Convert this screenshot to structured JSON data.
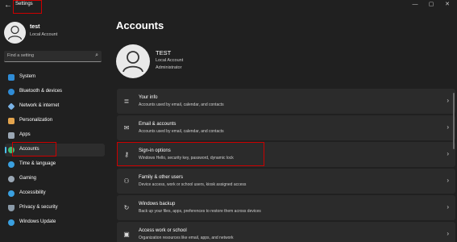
{
  "window": {
    "title": "Settings",
    "back_glyph": "←",
    "minimize_glyph": "—",
    "maximize_glyph": "▢",
    "close_glyph": "✕"
  },
  "sidebar": {
    "user": {
      "name": "test",
      "role": "Local Account"
    },
    "search": {
      "placeholder": "Find a setting",
      "icon": "search-icon"
    },
    "items": [
      {
        "label": "System",
        "icon": "system-icon",
        "color": "#2f8cd6"
      },
      {
        "label": "Bluetooth & devices",
        "icon": "bluetooth-icon",
        "color": "#2f8cd6"
      },
      {
        "label": "Network & internet",
        "icon": "network-icon",
        "color": "#7ab3e6"
      },
      {
        "label": "Personalization",
        "icon": "brush-icon",
        "color": "#e3a44d"
      },
      {
        "label": "Apps",
        "icon": "apps-icon",
        "color": "#9aa7b4"
      },
      {
        "label": "Accounts",
        "icon": "accounts-icon",
        "color": "#3fbf72",
        "active": true
      },
      {
        "label": "Time & language",
        "icon": "globe-icon",
        "color": "#3aa0e0"
      },
      {
        "label": "Gaming",
        "icon": "gaming-icon",
        "color": "#9aa7b4"
      },
      {
        "label": "Accessibility",
        "icon": "accessibility-icon",
        "color": "#3aa0e0"
      },
      {
        "label": "Privacy & security",
        "icon": "shield-icon",
        "color": "#8a9aa8"
      },
      {
        "label": "Windows Update",
        "icon": "update-icon",
        "color": "#3aa0e0"
      }
    ]
  },
  "main": {
    "title": "Accounts",
    "account": {
      "name": "TEST",
      "type": "Local Account",
      "role": "Administrator"
    },
    "cards": [
      {
        "title": "Your info",
        "desc": "Accounts used by email, calendar, and contacts",
        "icon": "person-card-icon",
        "glyph": "≣"
      },
      {
        "title": "Email & accounts",
        "desc": "Accounts used by email, calendar, and contacts",
        "icon": "mail-icon",
        "glyph": "✉"
      },
      {
        "title": "Sign-in options",
        "desc": "Windows Hello, security key, password, dynamic lock",
        "icon": "key-icon",
        "glyph": "⚷"
      },
      {
        "title": "Family & other users",
        "desc": "Device access, work or school users, kiosk assigned access",
        "icon": "family-icon",
        "glyph": "⚇"
      },
      {
        "title": "Windows backup",
        "desc": "Back up your files, apps, preferences to restore them across devices",
        "icon": "backup-icon",
        "glyph": "↻"
      },
      {
        "title": "Access work or school",
        "desc": "Organization resources like email, apps, and network",
        "icon": "briefcase-icon",
        "glyph": "▣"
      }
    ],
    "chevron": "›"
  },
  "colors": {
    "accent": "#4cc2ff",
    "highlight": "#cc0000",
    "background": "#202020",
    "card": "#2b2b2b"
  }
}
